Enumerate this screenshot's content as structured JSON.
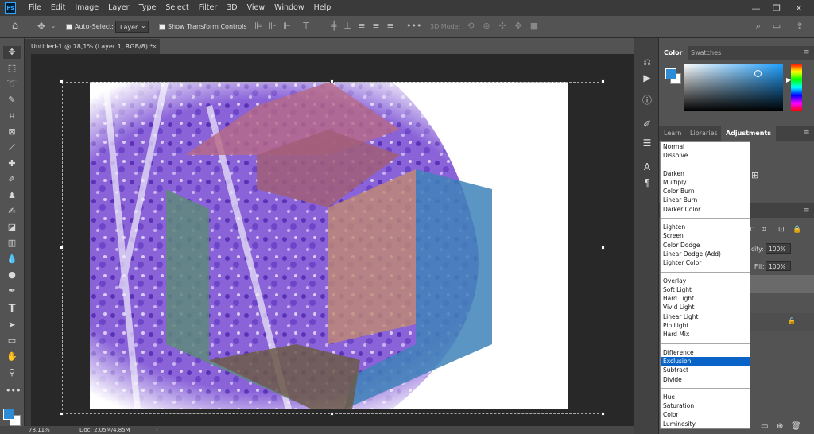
{
  "app": {
    "logo": "Ps"
  },
  "menu": [
    "File",
    "Edit",
    "Image",
    "Layer",
    "Type",
    "Select",
    "Filter",
    "3D",
    "View",
    "Window",
    "Help"
  ],
  "options": {
    "auto_select_label": "Auto-Select:",
    "auto_select_value": "Layer",
    "show_transform_label": "Show Transform Controls",
    "mode_label": "3D Mode:"
  },
  "document": {
    "tab_label": "Untitled-1 @ 78,1% (Layer 1, RGB/8) *",
    "close": "×",
    "zoom": "78.11%",
    "doc_info": "Doc: 2,05M/4,85M"
  },
  "panels": {
    "color_tabs": [
      "Color",
      "Swatches"
    ],
    "adj_tabs": [
      "Learn",
      "Libraries",
      "Adjustments"
    ],
    "opacity_label": "city:",
    "opacity_value": "100%",
    "fill_label": "Fill:",
    "fill_value": "100%"
  },
  "colors": {
    "foreground": "#2e8bd6",
    "accent": "#0a64c8"
  },
  "blend_modes": [
    [
      "Normal",
      "Dissolve"
    ],
    [
      "Darken",
      "Multiply",
      "Color Burn",
      "Linear Burn",
      "Darker Color"
    ],
    [
      "Lighten",
      "Screen",
      "Color Dodge",
      "Linear Dodge (Add)",
      "Lighter Color"
    ],
    [
      "Overlay",
      "Soft Light",
      "Hard Light",
      "Vivid Light",
      "Linear Light",
      "Pin Light",
      "Hard Mix"
    ],
    [
      "Difference",
      "Exclusion",
      "Subtract",
      "Divide"
    ],
    [
      "Hue",
      "Saturation",
      "Color",
      "Luminosity"
    ]
  ],
  "selected_blend_mode": "Exclusion"
}
